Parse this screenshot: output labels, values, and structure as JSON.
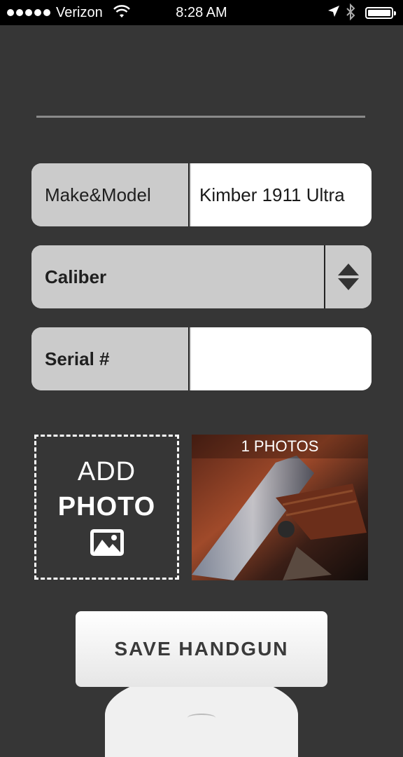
{
  "status_bar": {
    "carrier": "Verizon",
    "time": "8:28 AM"
  },
  "form": {
    "make_model": {
      "label": "Make&Model",
      "value": "Kimber 1911 Ultra"
    },
    "caliber": {
      "label": "Caliber"
    },
    "serial": {
      "label": "Serial #",
      "value": ""
    }
  },
  "photos": {
    "add_line1": "ADD",
    "add_line2": "PHOTO",
    "count_label": "1 PHOTOS"
  },
  "save_button": {
    "label": "SAVE HANDGUN"
  },
  "icons": [
    "wifi-icon",
    "location-arrow-icon",
    "bluetooth-icon",
    "battery-icon",
    "sort-arrows-icon",
    "image-icon"
  ]
}
